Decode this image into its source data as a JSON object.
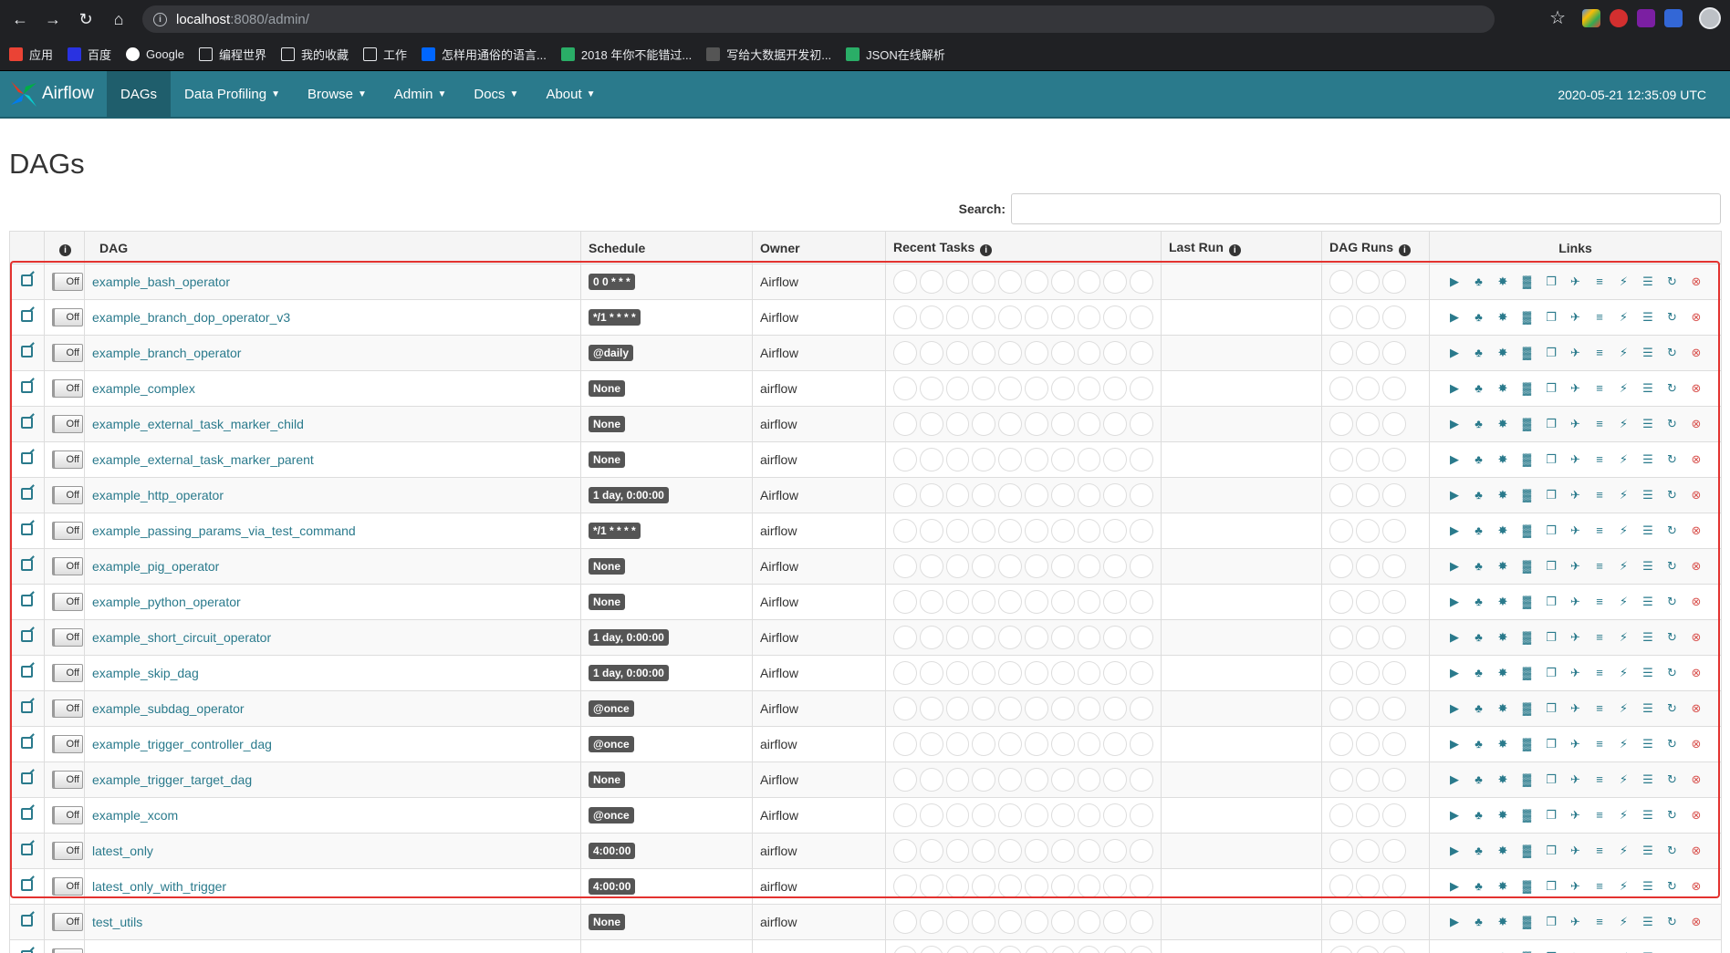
{
  "browser": {
    "url_host": "localhost",
    "url_path": ":8080/admin/",
    "bookmarks": [
      {
        "label": "应用",
        "icon": "apps-icon"
      },
      {
        "label": "百度",
        "icon": "baidu-icon"
      },
      {
        "label": "Google",
        "icon": "google-icon"
      },
      {
        "label": "编程世界",
        "icon": "folder-icon"
      },
      {
        "label": "我的收藏",
        "icon": "folder-icon"
      },
      {
        "label": "工作",
        "icon": "folder-icon"
      },
      {
        "label": "怎样用通俗的语言...",
        "icon": "zhihu-icon"
      },
      {
        "label": "2018 年你不能错过...",
        "icon": "wechat-icon"
      },
      {
        "label": "写给大数据开发初...",
        "icon": "page-icon"
      },
      {
        "label": "JSON在线解析",
        "icon": "json-icon"
      }
    ]
  },
  "navbar": {
    "brand": "Airflow",
    "items": [
      {
        "label": "DAGs",
        "active": true
      },
      {
        "label": "Data Profiling",
        "dropdown": true
      },
      {
        "label": "Browse",
        "dropdown": true
      },
      {
        "label": "Admin",
        "dropdown": true
      },
      {
        "label": "Docs",
        "dropdown": true
      },
      {
        "label": "About",
        "dropdown": true
      }
    ],
    "time": "2020-05-21 12:35:09 UTC"
  },
  "page": {
    "title": "DAGs",
    "search_label": "Search:",
    "search_value": ""
  },
  "table": {
    "headers": {
      "info": "i",
      "dag": "DAG",
      "schedule": "Schedule",
      "owner": "Owner",
      "recent_tasks": "Recent Tasks",
      "last_run": "Last Run",
      "dag_runs": "DAG Runs",
      "links": "Links"
    },
    "toggle_label": "Off",
    "rows": [
      {
        "dag": "example_bash_operator",
        "schedule": "0 0 * * *",
        "owner": "Airflow"
      },
      {
        "dag": "example_branch_dop_operator_v3",
        "schedule": "*/1 * * * *",
        "owner": "Airflow"
      },
      {
        "dag": "example_branch_operator",
        "schedule": "@daily",
        "owner": "Airflow"
      },
      {
        "dag": "example_complex",
        "schedule": "None",
        "owner": "airflow"
      },
      {
        "dag": "example_external_task_marker_child",
        "schedule": "None",
        "owner": "airflow"
      },
      {
        "dag": "example_external_task_marker_parent",
        "schedule": "None",
        "owner": "airflow"
      },
      {
        "dag": "example_http_operator",
        "schedule": "1 day, 0:00:00",
        "owner": "Airflow"
      },
      {
        "dag": "example_passing_params_via_test_command",
        "schedule": "*/1 * * * *",
        "owner": "airflow"
      },
      {
        "dag": "example_pig_operator",
        "schedule": "None",
        "owner": "Airflow"
      },
      {
        "dag": "example_python_operator",
        "schedule": "None",
        "owner": "Airflow"
      },
      {
        "dag": "example_short_circuit_operator",
        "schedule": "1 day, 0:00:00",
        "owner": "Airflow"
      },
      {
        "dag": "example_skip_dag",
        "schedule": "1 day, 0:00:00",
        "owner": "Airflow"
      },
      {
        "dag": "example_subdag_operator",
        "schedule": "@once",
        "owner": "Airflow"
      },
      {
        "dag": "example_trigger_controller_dag",
        "schedule": "@once",
        "owner": "airflow"
      },
      {
        "dag": "example_trigger_target_dag",
        "schedule": "None",
        "owner": "Airflow"
      },
      {
        "dag": "example_xcom",
        "schedule": "@once",
        "owner": "Airflow"
      },
      {
        "dag": "latest_only",
        "schedule": "4:00:00",
        "owner": "airflow"
      },
      {
        "dag": "latest_only_with_trigger",
        "schedule": "4:00:00",
        "owner": "airflow"
      },
      {
        "dag": "test_utils",
        "schedule": "None",
        "owner": "airflow"
      },
      {
        "dag": "",
        "schedule": "",
        "owner": ""
      }
    ],
    "link_icons": [
      "trigger-icon",
      "tree-icon",
      "graph-icon",
      "duration-icon",
      "tries-icon",
      "landing-icon",
      "gantt-icon",
      "code-icon",
      "logs-icon",
      "refresh-icon",
      "delete-icon"
    ]
  },
  "colors": {
    "accent": "#2a7a8c",
    "highlight": "#e3322f",
    "delete": "#d9534f"
  }
}
